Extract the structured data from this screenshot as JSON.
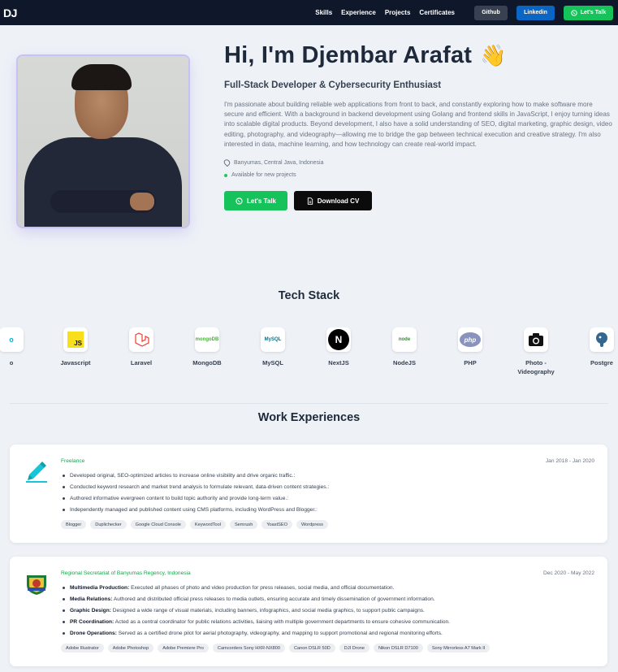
{
  "nav": {
    "logo": "DJ",
    "links": [
      "Skills",
      "Experience",
      "Projects",
      "Certificates"
    ],
    "github": "Github",
    "linkedin": "Linkedin",
    "talk": "Let's Talk"
  },
  "hero": {
    "title": "Hi, I'm Djembar Arafat",
    "subtitle": "Full-Stack Developer & Cybersecurity Enthusiast",
    "description": "I'm passionate about building reliable web applications from front to back, and constantly exploring how to make software more secure and efficient. With a background in backend development using Golang and frontend skills in JavaScript, I enjoy turning ideas into scalable digital products. Beyond development, I also have a solid understanding of SEO, digital marketing, graphic design, video editing, photography, and videography—allowing me to bridge the gap between technical execution and creative strategy. I'm also interested in data, machine learning, and how technology can create real-world impact.",
    "location": "Banyumas, Central Java, Indonesia",
    "availability": "Available for new projects",
    "talk_label": "Let's Talk",
    "cv_label": "Download CV"
  },
  "tech_stack": {
    "title": "Tech Stack",
    "items": [
      "o",
      "Javascript",
      "Laravel",
      "MongoDB",
      "MySQL",
      "NextJS",
      "NodeJS",
      "PHP",
      "Photo - Videography",
      "Postgre"
    ]
  },
  "experience": {
    "title": "Work Experiences",
    "jobs": [
      {
        "org": "Freelance",
        "date": "Jan 2018 - Jan 2020",
        "bullets": [
          "Developed original, SEO-optimized articles to increase online visibility and drive organic traffic.:",
          "Conducted keyword research and market trend analysis to formulate relevant, data-driven content strategies.:",
          "Authored informative evergreen content to build topic authority and provide long-term value.:",
          "Independently managed and published content using CMS platforms, including WordPress and Blogger.:"
        ],
        "tags": [
          "Blogger",
          "Duplichecker",
          "Google Cloud Console",
          "KeywordTool",
          "Semrush",
          "YoastSEO",
          "Wordpress"
        ]
      },
      {
        "org": "Regional Secretariat of Banyumas Regency, Indonesia",
        "date": "Dec 2020 - May 2022",
        "bullets": [
          {
            "title": "Multimedia Production:",
            "text": " Executed all phases of photo and video production for press releases, social media, and official documentation."
          },
          {
            "title": "Media Relations:",
            "text": " Authored and distributed official press releases to media outlets, ensuring accurate and timely dissemination of government information."
          },
          {
            "title": "Graphic Design:",
            "text": " Designed a wide range of visual materials, including banners, infographics, and social media graphics, to support public campaigns."
          },
          {
            "title": "PR Coordination:",
            "text": " Acted as a central coordinator for public relations activities, liaising with multiple government departments to ensure cohesive communication."
          },
          {
            "title": "Drone Operations:",
            "text": " Served as a certified drone pilot for aerial photography, videography, and mapping to support promotional and regional monitoring efforts."
          }
        ],
        "tags": [
          "Adobe Illustrator",
          "Adobe Photoshop",
          "Adobe Premiere Pro",
          "Camcorders Sony HXR-NX800",
          "Canon DSLR 50D",
          "DJI Drone",
          "Nikon DSLR D7100",
          "Sony Mirrorless A7 Mark II"
        ]
      }
    ]
  }
}
